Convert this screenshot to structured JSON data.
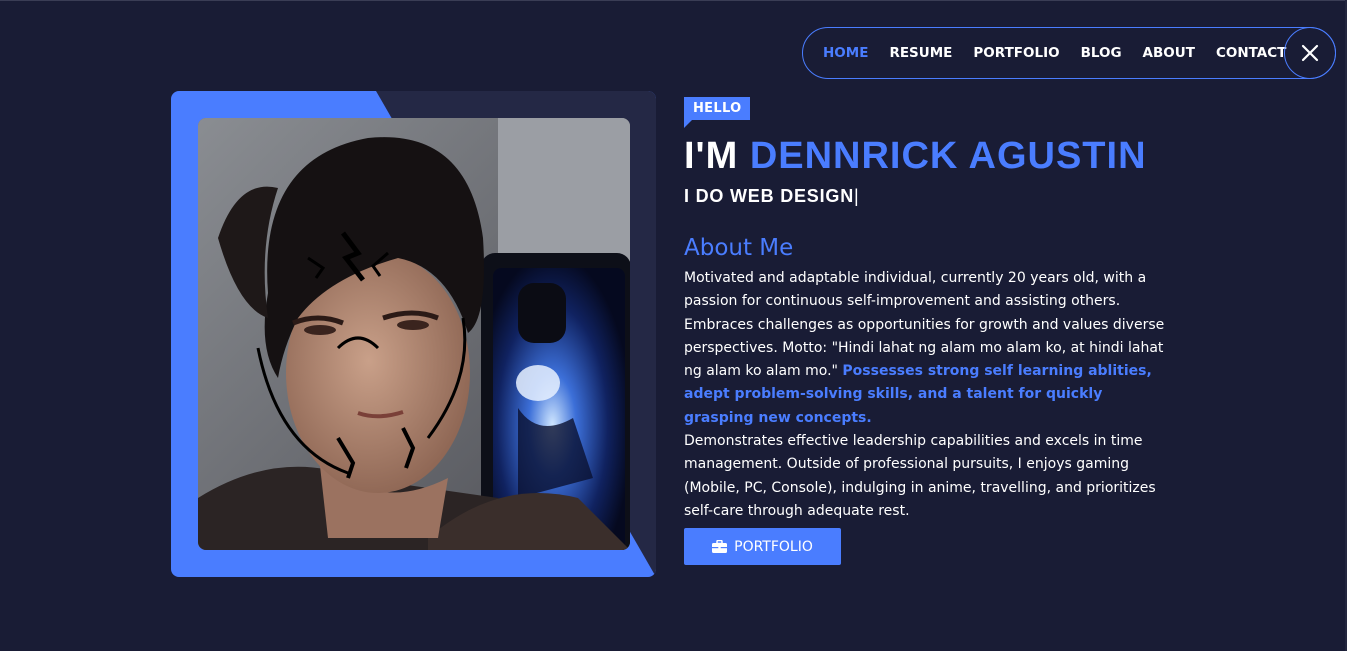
{
  "nav": {
    "items": [
      {
        "label": "HOME",
        "active": true
      },
      {
        "label": "RESUME",
        "active": false
      },
      {
        "label": "PORTFOLIO",
        "active": false
      },
      {
        "label": "BLOG",
        "active": false
      },
      {
        "label": "ABOUT",
        "active": false
      },
      {
        "label": "CONTACT",
        "active": false
      }
    ],
    "close_icon": "close-icon"
  },
  "hero": {
    "tag": "HELLO",
    "greeting": "I'M",
    "name": "DENNRICK AGUSTIN",
    "role": "I DO WEB DESIGN",
    "cursor": "|"
  },
  "about": {
    "title": "About Me",
    "text_1": "Motivated and adaptable individual, currently 20 years old, with a pas­sion for continuous self-improvement and assisting others. Embraces challenges as opportunities for growth and values diverse perspectives. Motto: \"Hindi lahat ng alam mo alam ko, at hindi lahat ng alam ko alam mo.\" ",
    "highlight": "Possesses strong self learning ablities, adept problem-solving skills, and a talent for quickly grasping new concepts.",
    "text_2": "Demonstrates effective leadership capabilities and excels in time man­agement. Outside of professional pursuits, I enjoys gaming (Mobile, PC, Console), indulging in anime, travelling, and prioritizes self-care through adequate rest."
  },
  "cta": {
    "label": "PORTFOLIO",
    "icon": "briefcase-icon"
  },
  "colors": {
    "background": "#191c35",
    "accent": "#4a7dff",
    "card_dark": "#242845"
  }
}
